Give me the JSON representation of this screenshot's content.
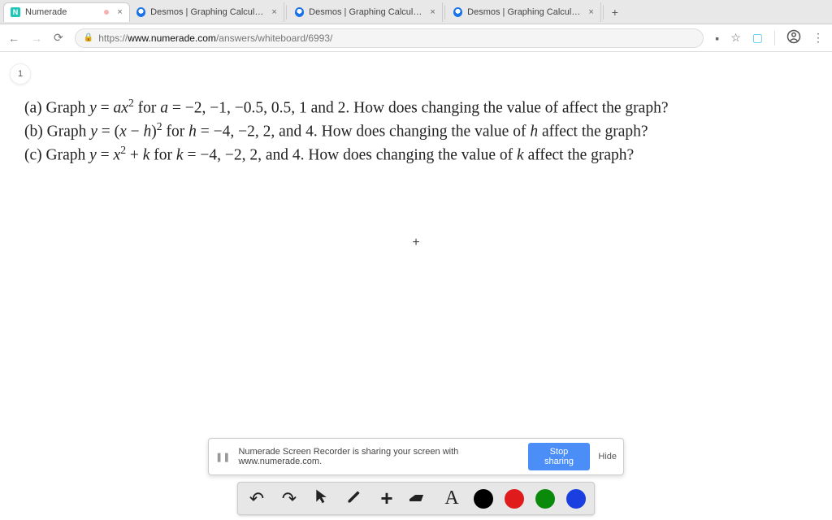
{
  "tabs": [
    {
      "title": "Numerade",
      "favicon": "numerade",
      "fav_letter": "N",
      "active": true
    },
    {
      "title": "Desmos | Graphing Calculator",
      "favicon": "desmos"
    },
    {
      "title": "Desmos | Graphing Calculator",
      "favicon": "desmos"
    },
    {
      "title": "Desmos | Graphing Calculator",
      "favicon": "desmos"
    }
  ],
  "address": {
    "scheme": "https://",
    "domain": "www.numerade.com",
    "path": "/answers/whiteboard/6993/"
  },
  "page_number": "1",
  "problem": {
    "a_pre": "(a) Graph ",
    "a_eq1a": "y",
    "a_eq1_op": " = ",
    "a_eq1b": "ax",
    "a_eq1_sup": "2",
    "a_mid": " for ",
    "a_var": "a",
    "a_vals": " = −2, −1, −0.5, 0.5, 1 and 2. How does changing the value of affect the graph?",
    "b_pre": "(b) Graph ",
    "b_eq1": "y",
    "b_op": " = (",
    "b_eq2": "x",
    "b_mid1": " − ",
    "b_eq3": "h",
    "b_close": ")",
    "b_sup": "2",
    "b_for": " for ",
    "b_var": "h",
    "b_vals": " = −4, −2, 2, and 4. How does changing the value of ",
    "b_var2": "h",
    "b_tail": " affect the graph?",
    "c_pre": "(c) Graph ",
    "c_eq1": "y",
    "c_op": " = ",
    "c_eq2": "x",
    "c_sup": "2",
    "c_mid": " + ",
    "c_eq3": "k",
    "c_for": " for ",
    "c_var": "k",
    "c_vals": " = −4, −2, 2, and 4. How does changing the value of ",
    "c_var2": "k",
    "c_tail": " affect the graph?"
  },
  "share": {
    "text": "Numerade Screen Recorder is sharing your screen with www.numerade.com.",
    "stop": "Stop sharing",
    "hide": "Hide"
  },
  "colors": {
    "black": "#000000",
    "red": "#e01b1b",
    "green": "#0a8a0a",
    "blue": "#1a3fe0"
  }
}
